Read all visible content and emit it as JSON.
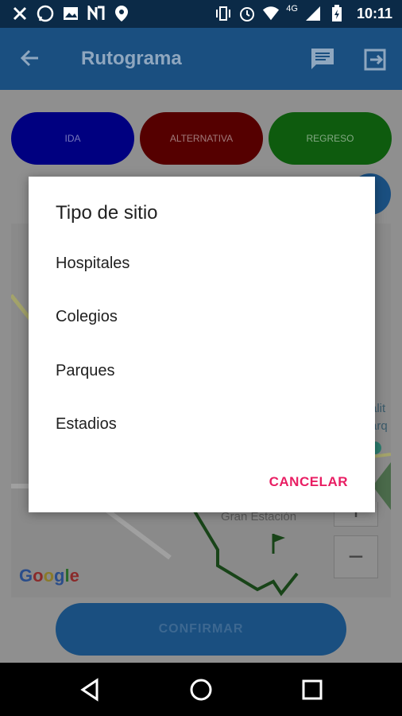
{
  "status_bar": {
    "time": "10:11",
    "network": "4G",
    "icons": [
      "tools-icon",
      "whatsapp-icon",
      "image-icon",
      "n-app-icon",
      "maps-marker-icon",
      "vibrate-icon",
      "alarm-icon",
      "wifi-icon",
      "signal-icon",
      "battery-icon"
    ]
  },
  "app_bar": {
    "title": "Rutograma",
    "back_icon": "arrow-back-icon",
    "actions": [
      "message-icon",
      "exit-icon"
    ]
  },
  "route_buttons": {
    "ida": "IDA",
    "alternativa": "ALTERNATIVA",
    "regreso": "REGRESO",
    "colors": {
      "ida": "#000080",
      "alternativa": "#550000",
      "regreso": "#0e5b0e"
    }
  },
  "map": {
    "place_label": "Gran Estación",
    "side_text": "alit\narq",
    "logo": "Google",
    "zoom_in": "+",
    "zoom_out": "−"
  },
  "confirm_label": "CONFIRMAR",
  "dialog": {
    "title": "Tipo de sitio",
    "options": [
      "Hospitales",
      "Colegios",
      "Parques",
      "Estadios"
    ],
    "cancel_label": "CANCELAR",
    "accent": "#e91e63"
  },
  "nav_bar": {
    "back_icon": "triangle-back-icon",
    "home_icon": "circle-home-icon",
    "recents_icon": "square-recents-icon"
  }
}
